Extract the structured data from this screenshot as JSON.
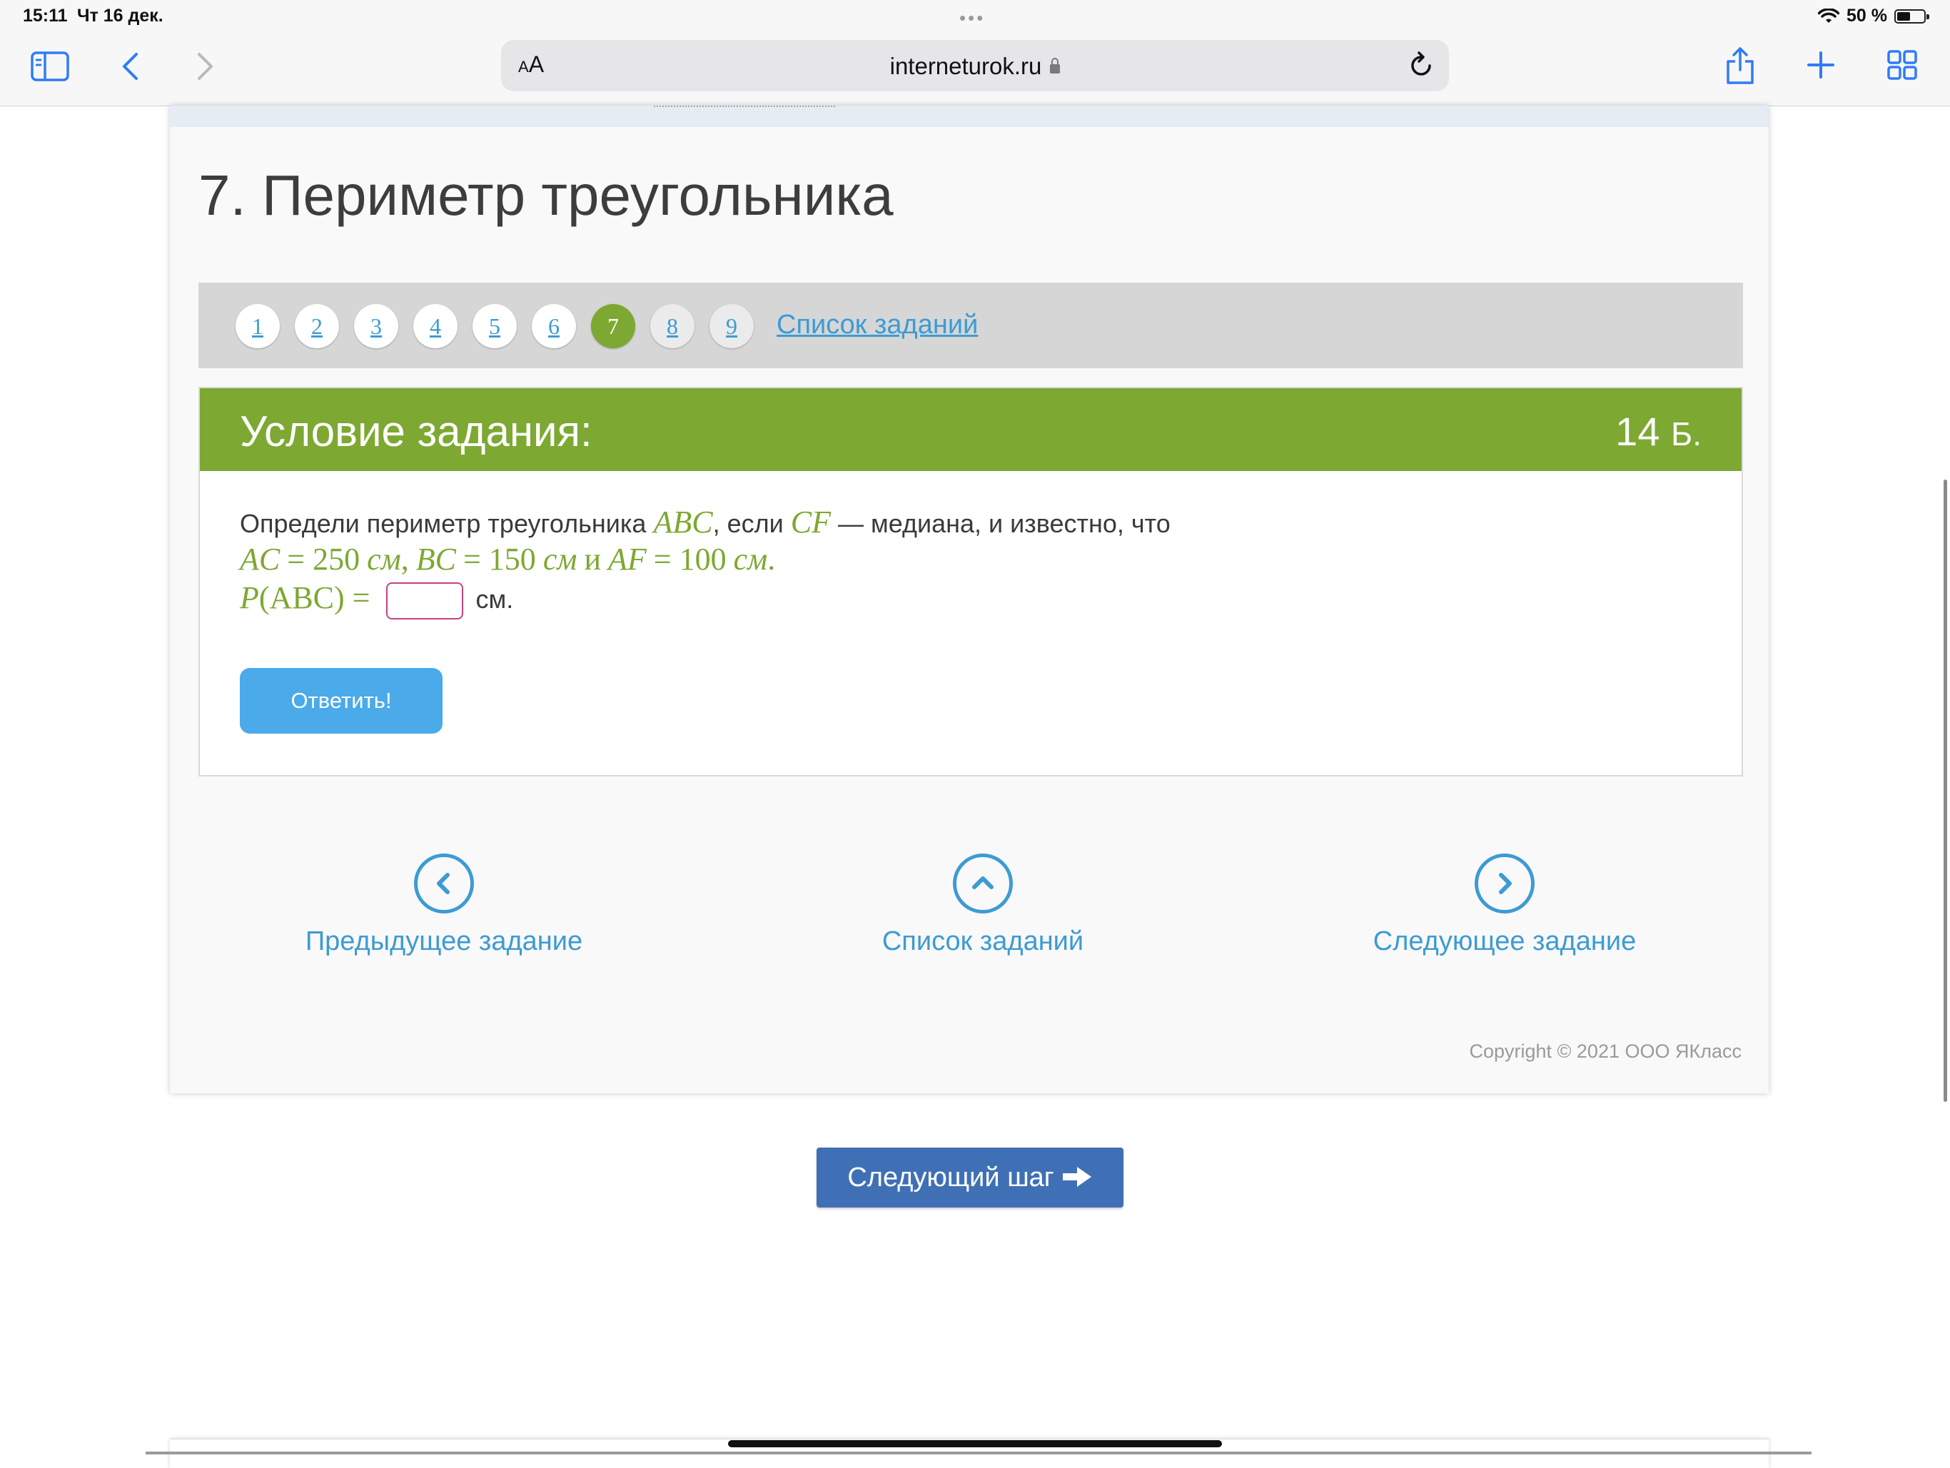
{
  "status_bar": {
    "time": "15:11",
    "date": "Чт 16 дек.",
    "battery": "50 %",
    "battery_level": 0.5
  },
  "browser": {
    "text_size_label": "AA",
    "url": "interneturok.ru"
  },
  "page": {
    "title": "7. Периметр треугольника"
  },
  "pager": {
    "items": [
      "1",
      "2",
      "3",
      "4",
      "5",
      "6",
      "7",
      "8",
      "9"
    ],
    "active": "7",
    "list_link": "Список заданий"
  },
  "task": {
    "header": "Условие задания:",
    "points": "14",
    "points_unit": "Б.",
    "q_prefix": "Определи периметр треугольника",
    "q_abc": "ABC",
    "q_if": ", если",
    "q_cf": "CF",
    "q_rest": "— медиана, и известно, что",
    "eq_ac": "AC",
    "eq_ac_val": "= 250",
    "eq_bc": "BC",
    "eq_bc_val": "= 150",
    "eq_and": "и",
    "eq_af": "AF",
    "eq_af_val": "= 100",
    "unit_math": "см",
    "p_label": "P",
    "p_abc": "(ABC) =",
    "answer_value": "",
    "answer_unit": "см.",
    "submit_label": "Ответить!"
  },
  "navigation": {
    "prev_label": "Предыдущее задание",
    "list_label": "Список заданий",
    "next_label": "Следующее задание"
  },
  "copyright": "Copyright © 2021 ООО ЯКласс",
  "next_step_label": "Следующий шаг",
  "colors": {
    "green": "#7da832",
    "link_blue": "#3d9bd4",
    "button_blue": "#4aaaea",
    "next_step": "#3f70b6"
  }
}
